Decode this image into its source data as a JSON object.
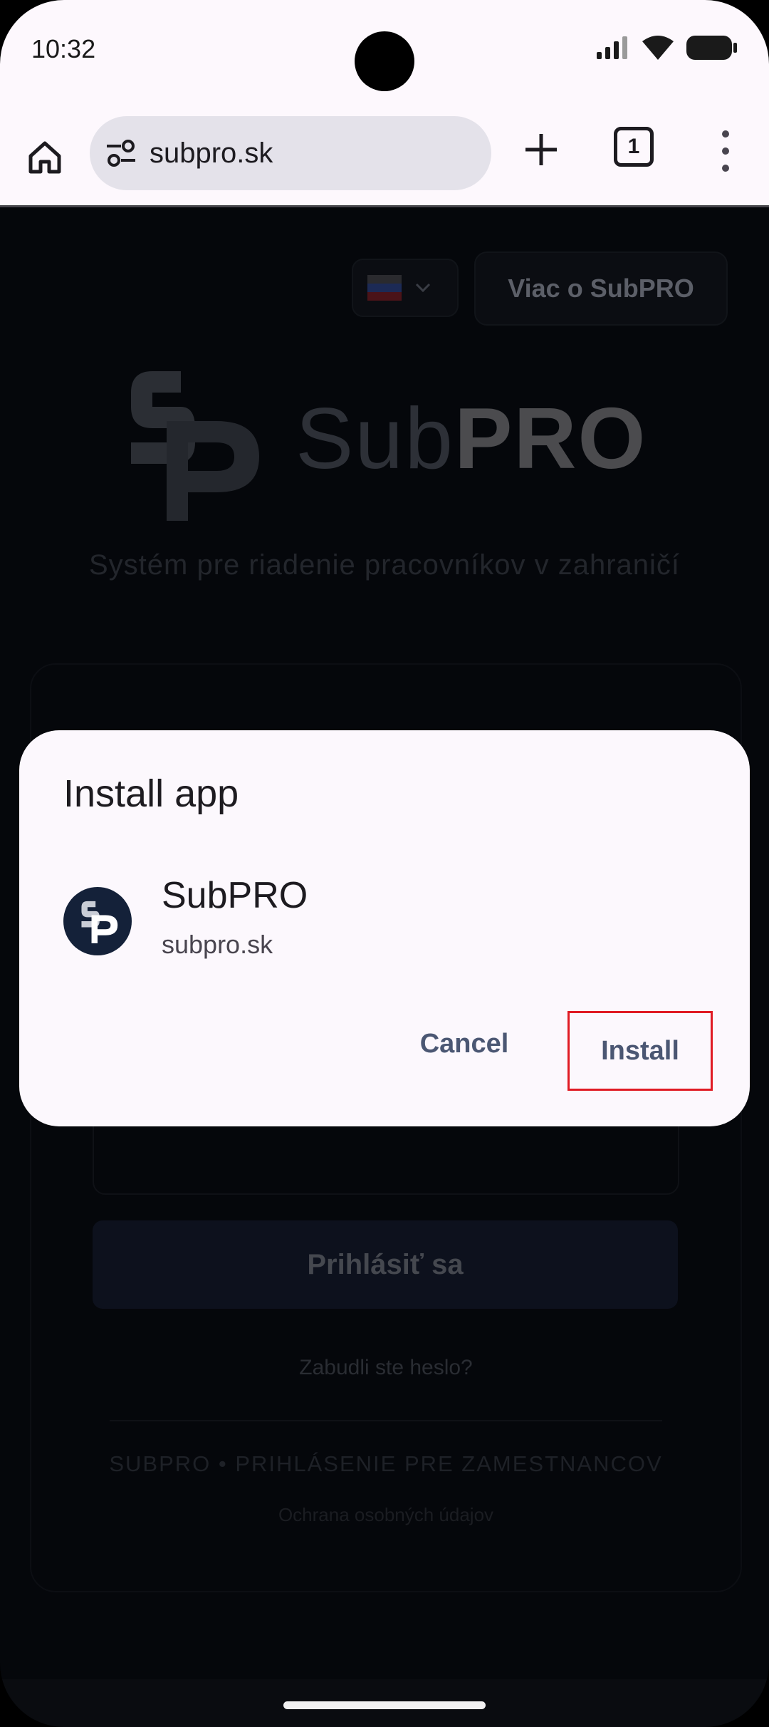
{
  "status_bar": {
    "time": "10:32"
  },
  "browser": {
    "url": "subpro.sk",
    "tab_count": "1"
  },
  "page": {
    "language_flag": "Slovakia",
    "more_button": "Viac o SubPRO",
    "logo_text_light": "Sub",
    "logo_text_bold": "PRO",
    "tagline": "Systém pre riadenie pracovníkov v zahraničí",
    "login_button": "Prihlásiť sa",
    "forgot_password": "Zabudli ste heslo?",
    "footer_title": "SUBPRO • PRIHLÁSENIE PRE ZAMESTNANCOV",
    "footer_link": "Ochrana osobných údajov"
  },
  "dialog": {
    "title": "Install app",
    "app_name": "SubPRO",
    "app_url": "subpro.sk",
    "cancel_label": "Cancel",
    "install_label": "Install"
  },
  "colors": {
    "accent": "#4b5773",
    "highlight": "#e01b24",
    "page_bg": "#05070b"
  }
}
